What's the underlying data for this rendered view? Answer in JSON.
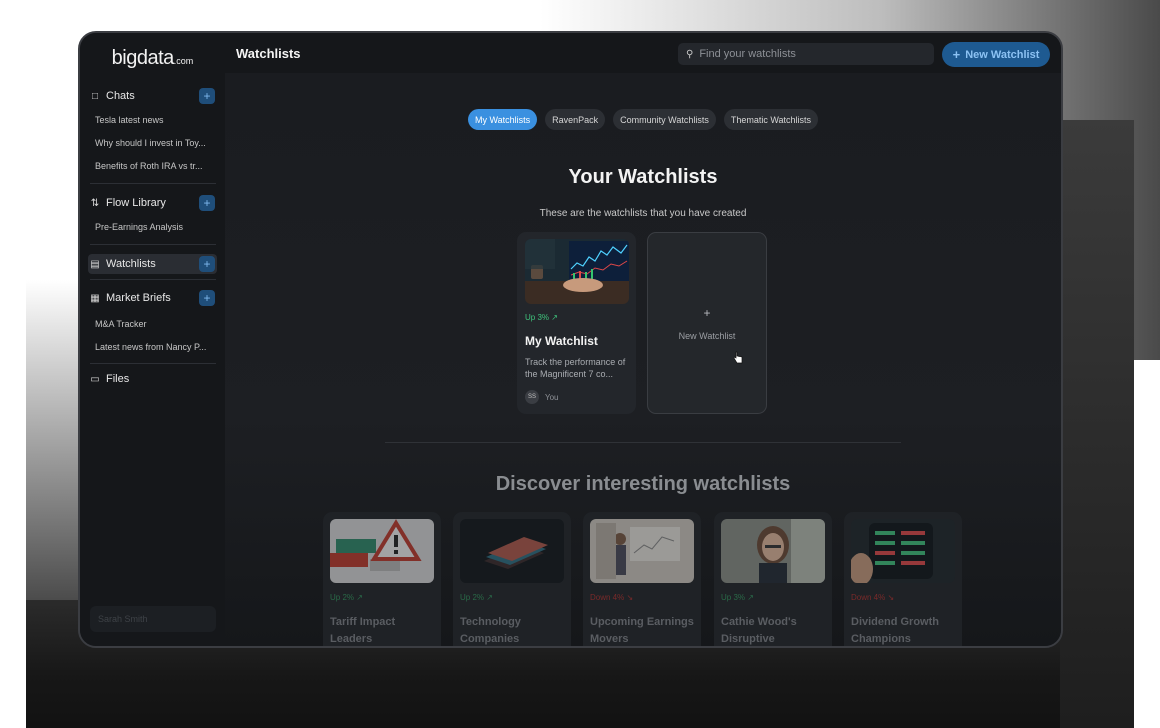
{
  "brand": {
    "logo": "bigdata",
    "logo_suffix": ".com"
  },
  "header": {
    "title": "Watchlists",
    "search_placeholder": "Find your watchlists",
    "new_button": "New Watchlist",
    "new_button_icon": "+"
  },
  "sidebar": {
    "sections": {
      "chats": {
        "label": "Chats",
        "icon": "chat-bubble-icon",
        "items": [
          "Tesla latest news",
          "Why should I invest in Toy...",
          "Benefits of Roth IRA vs tr..."
        ]
      },
      "flow_library": {
        "label": "Flow Library",
        "icon": "flow-icon",
        "items": [
          "Pre-Earnings Analysis"
        ]
      },
      "watchlists": {
        "label": "Watchlists",
        "icon": "list-icon"
      },
      "market_briefs": {
        "label": "Market Briefs",
        "icon": "newspaper-icon",
        "items": [
          "M&A Tracker",
          "Latest news from Nancy P..."
        ]
      },
      "files": {
        "label": "Files",
        "icon": "folder-icon"
      }
    },
    "plus": "+",
    "user": "Sarah Smith"
  },
  "tabs": [
    "My Watchlists",
    "RavenPack",
    "Community Watchlists",
    "Thematic Watchlists"
  ],
  "active_tab": "My Watchlists",
  "main": {
    "heading": "Your Watchlists",
    "subheading": "These are the watchlists that you have created",
    "my_watchlist": {
      "change": "Up 3%",
      "title": "My Watchlist",
      "description": "Track the performance of the Magnificent 7 co...",
      "owner_initials": "SS",
      "owner": "You"
    },
    "new_card": {
      "plus": "+",
      "label": "New Watchlist"
    },
    "discover_heading": "Discover interesting watchlists",
    "discover": [
      {
        "change": "Up 2%",
        "direction": "up",
        "title": "Tariff Impact Leaders"
      },
      {
        "change": "Up 2%",
        "direction": "up",
        "title": "Technology Companies"
      },
      {
        "change": "Down 4%",
        "direction": "down",
        "title": "Upcoming Earnings Movers"
      },
      {
        "change": "Up 3%",
        "direction": "up",
        "title": "Cathie Wood's Disruptive"
      },
      {
        "change": "Down 4%",
        "direction": "down",
        "title": "Dividend Growth Champions"
      }
    ]
  },
  "colors": {
    "accent": "#3a90e0",
    "up": "#3fc37c",
    "down": "#c0392b"
  }
}
